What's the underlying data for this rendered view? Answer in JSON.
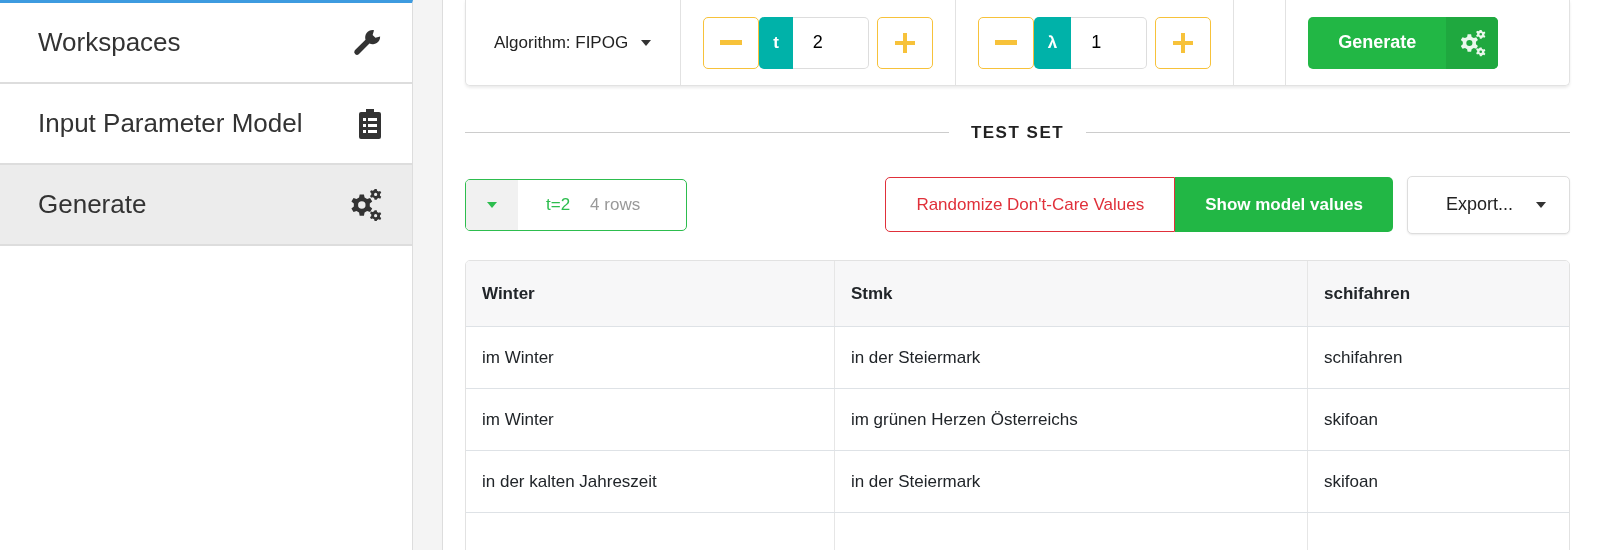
{
  "sidebar": {
    "items": [
      {
        "label": "Workspaces",
        "selected": false
      },
      {
        "label": "Input Parameter Model",
        "selected": false
      },
      {
        "label": "Generate",
        "selected": true
      }
    ]
  },
  "toolbar": {
    "algorithm": "Algorithm: FIPOG",
    "steppers": [
      {
        "label": "t",
        "value": "2"
      },
      {
        "label": "λ",
        "value": "1"
      }
    ],
    "generate_button": "Generate"
  },
  "section_title": "TEST SET",
  "test_set": {
    "selector": {
      "value": "t=2",
      "count": "4 rows"
    },
    "randomize_button": "Randomize Don't-Care Values",
    "show_values_button": "Show model values",
    "export_button": "Export..."
  },
  "table": {
    "columns": [
      "Winter",
      "Stmk",
      "schifahren"
    ],
    "rows": [
      [
        "im Winter",
        "in der Steiermark",
        "schifahren"
      ],
      [
        "im Winter",
        "im grünen Herzen Österreichs",
        "skifoan"
      ],
      [
        "in der kalten Jahreszeit",
        "in der Steiermark",
        "skifoan"
      ]
    ]
  }
}
